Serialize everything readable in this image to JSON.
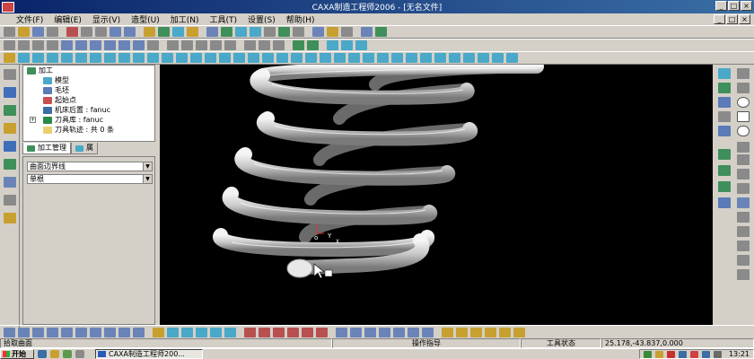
{
  "window": {
    "title": "CAXA制造工程师2006 - [无名文件]",
    "buttons": [
      "_",
      "□",
      "×"
    ]
  },
  "menu": {
    "items": [
      "文件(F)",
      "编辑(E)",
      "显示(V)",
      "造型(U)",
      "加工(N)",
      "工具(T)",
      "设置(S)",
      "帮助(H)"
    ]
  },
  "tree": {
    "root": "加工",
    "items": [
      {
        "label": "模型",
        "icon": "model-icon"
      },
      {
        "label": "毛坯",
        "icon": "blank-icon"
      },
      {
        "label": "起始点",
        "icon": "start-point-icon"
      },
      {
        "label": "机床后置 : fanuc",
        "icon": "machine-post-icon"
      },
      {
        "label": "刀具库 : fanuc",
        "icon": "tool-library-icon"
      },
      {
        "label": "刀具轨迹 : 共 0 条",
        "icon": "toolpath-folder-icon"
      }
    ]
  },
  "tabs": [
    {
      "label": "加工管理",
      "active": true
    },
    {
      "label": "属",
      "active": false
    }
  ],
  "properties": {
    "boundary_select": "曲面边界线",
    "mode_select": "单根"
  },
  "viewport": {
    "axis_labels": {
      "origin": "o",
      "y": "Y",
      "x": "X"
    }
  },
  "status": {
    "prompt": "拾取曲面",
    "command_hint": "操作指导",
    "tool_state": "工具状态",
    "coordinates": "25.178,-43.837,0.000"
  },
  "taskbar": {
    "start": "开始",
    "task_label": "CAXA制造工程师200...",
    "clock": "13:21"
  }
}
